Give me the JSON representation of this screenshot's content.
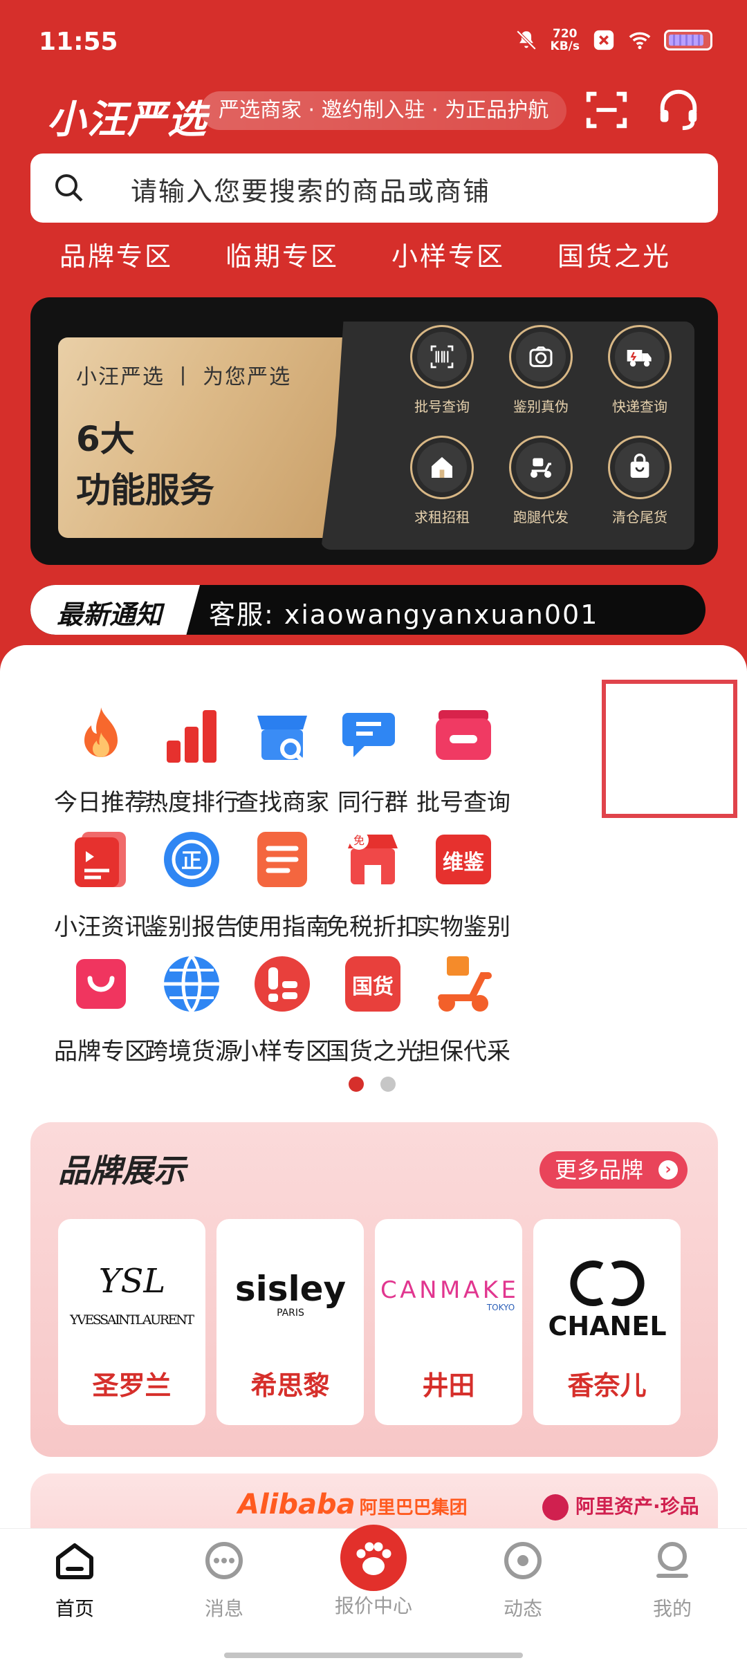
{
  "status_bar": {
    "time": "11:55",
    "speed_value": "720",
    "speed_unit": "KB/s"
  },
  "header": {
    "logo": "小汪严选",
    "slogan": "严选商家 · 邀约制入驻 · 为正品护航",
    "search_placeholder": "请输入您要搜索的商品或商铺",
    "quick_tabs": [
      "品牌专区",
      "临期专区",
      "小样专区",
      "国货之光"
    ]
  },
  "banner": {
    "subtitle": "小汪严选 丨 为您严选",
    "title_line1": "6大",
    "title_line2": "功能服务",
    "services": [
      "批号查询",
      "鉴别真伪",
      "快递查询",
      "求租招租",
      "跑腿代发",
      "清仓尾货"
    ]
  },
  "notice": {
    "tag": "最新通知",
    "message": "客服: xiaowangyanxuan001"
  },
  "grid": [
    {
      "label": "今日推荐",
      "icon": "fire-icon"
    },
    {
      "label": "热度排行",
      "icon": "bar-chart-icon"
    },
    {
      "label": "查找商家",
      "icon": "store-search-icon"
    },
    {
      "label": "同行群",
      "icon": "chat-icon"
    },
    {
      "label": "批号查询",
      "icon": "batch-query-icon"
    },
    {
      "label": "小汪资讯",
      "icon": "news-icon"
    },
    {
      "label": "鉴别报告",
      "icon": "certificate-icon"
    },
    {
      "label": "使用指南",
      "icon": "guide-icon"
    },
    {
      "label": "免税折扣",
      "icon": "duty-free-icon"
    },
    {
      "label": "实物鉴别",
      "icon": "authenticate-icon"
    },
    {
      "label": "品牌专区",
      "icon": "shopping-bag-icon"
    },
    {
      "label": "跨境货源",
      "icon": "globe-icon"
    },
    {
      "label": "小样专区",
      "icon": "sample-icon"
    },
    {
      "label": "国货之光",
      "icon": "national-goods-icon"
    },
    {
      "label": "担保代采",
      "icon": "scooter-icon"
    }
  ],
  "brands": {
    "title": "品牌展示",
    "more": "更多品牌",
    "items": [
      {
        "name": "圣罗兰",
        "logo_text": "YVESSAINTLAURENT",
        "logo_mark": "YSL"
      },
      {
        "name": "希思黎",
        "logo_text": "sisley",
        "logo_sub": "PARIS"
      },
      {
        "name": "井田",
        "logo_text": "CANMAKE",
        "logo_sub": "TOKYO"
      },
      {
        "name": "香奈儿",
        "logo_text": "CHANEL"
      }
    ]
  },
  "partner_strip": {
    "alibaba": "Alibaba",
    "alibaba_group": "阿里巴巴集团",
    "zichan": "阿里资产·珍品"
  },
  "bottom_nav": [
    "首页",
    "消息",
    "报价中心",
    "动态",
    "我的"
  ],
  "colors": {
    "brand_red": "#d62f2b",
    "gold": "#d8b785",
    "pink": "#e9445a"
  }
}
